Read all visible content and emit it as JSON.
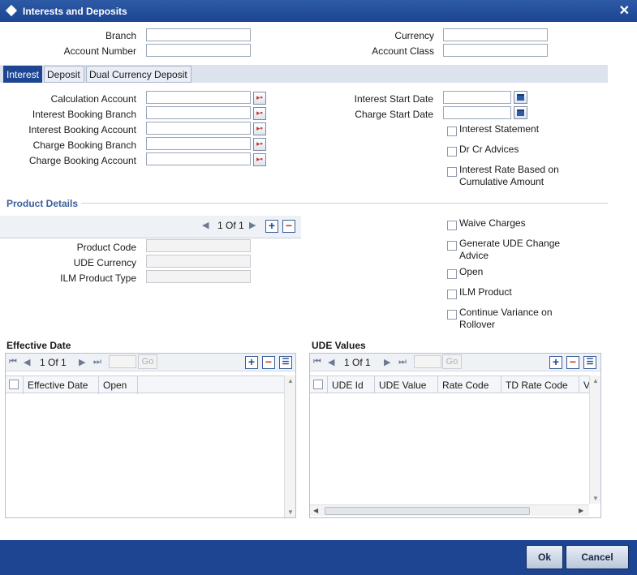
{
  "window": {
    "title": "Interests and Deposits",
    "close_glyph": "✕"
  },
  "header": {
    "branch_label": "Branch",
    "branch_value": "",
    "account_number_label": "Account Number",
    "account_number_value": "",
    "currency_label": "Currency",
    "currency_value": "",
    "account_class_label": "Account Class",
    "account_class_value": ""
  },
  "tabs": [
    {
      "label": "Interest",
      "active": true
    },
    {
      "label": "Deposit",
      "active": false
    },
    {
      "label": "Dual Currency Deposit",
      "active": false
    }
  ],
  "interest": {
    "calculation_account_label": "Calculation Account",
    "interest_booking_branch_label": "Interest Booking Branch",
    "interest_booking_account_label": "Interest Booking Account",
    "charge_booking_branch_label": "Charge Booking Branch",
    "charge_booking_account_label": "Charge Booking Account",
    "interest_start_date_label": "Interest Start Date",
    "charge_start_date_label": "Charge Start Date",
    "interest_statement_label": "Interest Statement",
    "dr_cr_advices_label": "Dr Cr Advices",
    "rate_cumulative_line1": "Interest Rate Based on",
    "rate_cumulative_line2": "Cumulative Amount"
  },
  "product_details": {
    "title": "Product Details",
    "pager": "1 Of 1",
    "product_code_label": "Product Code",
    "ude_currency_label": "UDE Currency",
    "ilm_product_type_label": "ILM Product Type",
    "waive_charges_label": "Waive Charges",
    "generate_ude_line1": "Generate UDE Change",
    "generate_ude_line2": "Advice",
    "open_label": "Open",
    "ilm_product_label": "ILM Product",
    "continue_variance_line1": "Continue Variance on",
    "continue_variance_line2": "Rollover"
  },
  "effective_date_grid": {
    "title": "Effective Date",
    "pager": "1 Of 1",
    "go_label": "Go",
    "columns": [
      "Effective Date",
      "Open"
    ]
  },
  "ude_values_grid": {
    "title": "UDE Values",
    "pager": "1 Of 1",
    "go_label": "Go",
    "columns": [
      "UDE Id",
      "UDE Value",
      "Rate Code",
      "TD Rate Code",
      "V"
    ]
  },
  "footer": {
    "ok_label": "Ok",
    "cancel_label": "Cancel"
  },
  "colors": {
    "title_bar": "#1d4592",
    "tab_active": "#1d4592",
    "section_title": "#3a5f9a"
  }
}
